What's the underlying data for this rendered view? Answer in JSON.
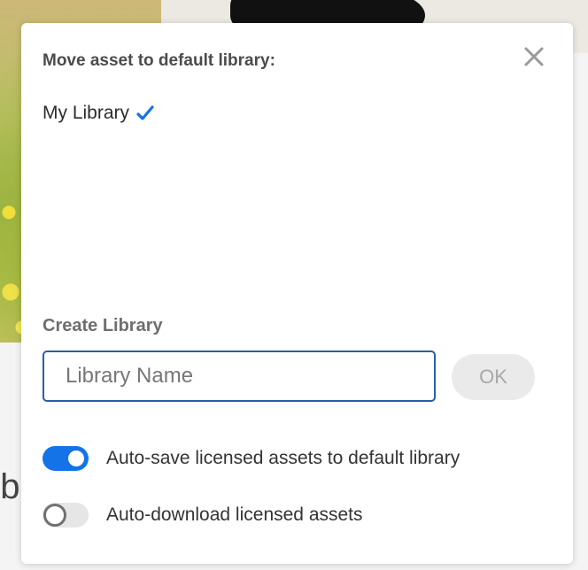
{
  "dialog": {
    "title": "Move asset to default library:",
    "close_icon": "close-icon",
    "library": {
      "name": "My Library",
      "selected": true,
      "check_icon": "checkmark-icon",
      "check_color": "#1473e6"
    },
    "create": {
      "label": "Create Library",
      "input_value": "",
      "input_placeholder": "Library Name",
      "ok_label": "OK",
      "ok_enabled": false
    },
    "toggles": [
      {
        "label": "Auto-save licensed assets to default library",
        "on": true
      },
      {
        "label": "Auto-download licensed assets",
        "on": false
      }
    ]
  },
  "background": {
    "partial_text": "ob"
  },
  "colors": {
    "accent": "#1473e6",
    "input_border": "#2a5ea6",
    "title": "#4b4b4b"
  }
}
